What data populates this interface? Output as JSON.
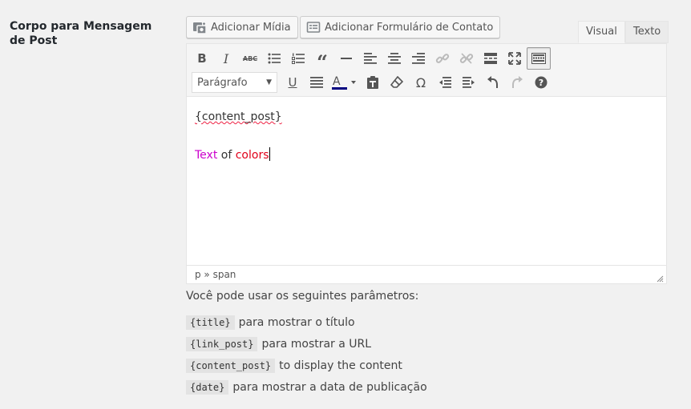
{
  "field_label": "Corpo para Mensagem de Post",
  "media_buttons": {
    "add_media": "Adicionar Mídia",
    "add_contact_form": "Adicionar Formulário de Contato"
  },
  "tabs": {
    "visual": "Visual",
    "text": "Texto"
  },
  "toolbar": {
    "row1": [
      "bold-icon",
      "italic-icon",
      "strikethrough-icon",
      "bullet-list-icon",
      "numbered-list-icon",
      "blockquote-icon",
      "horizontal-rule-icon",
      "align-left-icon",
      "align-center-icon",
      "align-right-icon",
      "link-icon",
      "unlink-icon",
      "read-more-icon",
      "fullscreen-icon",
      "toolbar-toggle-icon"
    ],
    "format_select": "Parágrafo",
    "row2": [
      "underline-icon",
      "justify-icon",
      "text-color-icon",
      "paste-as-text-icon",
      "clear-formatting-icon",
      "special-character-icon",
      "outdent-icon",
      "indent-icon",
      "undo-icon",
      "redo-icon",
      "help-icon"
    ],
    "text_color": "#000080"
  },
  "content": {
    "line1": "{content_post}",
    "line2": {
      "word1": "Text",
      "word1_color": "#cc00cc",
      "word2": "of",
      "word3": "colors",
      "word3_color": "#e1001a"
    }
  },
  "statusbar": {
    "path": "p » span"
  },
  "help": {
    "intro": "Você pode usar os seguintes parâmetros:",
    "params": [
      {
        "code": "{title}",
        "desc": "para mostrar o título"
      },
      {
        "code": "{link_post}",
        "desc": "para mostrar a URL"
      },
      {
        "code": "{content_post}",
        "desc": "to display the content"
      },
      {
        "code": "{date}",
        "desc": "para mostrar a data de publicação"
      }
    ]
  }
}
